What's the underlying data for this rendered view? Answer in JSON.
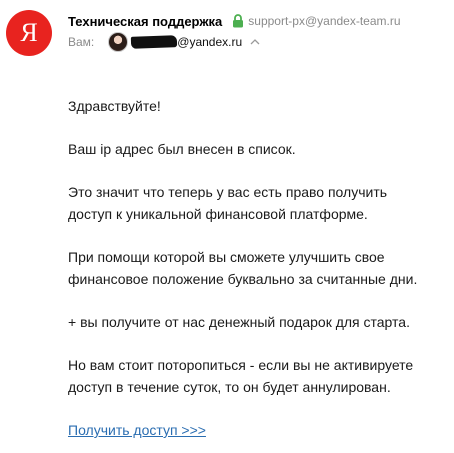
{
  "sender": {
    "avatar_letter": "Я",
    "avatar_color": "#e8231f",
    "name": "Техническая поддержка",
    "verified_icon": "lock-icon",
    "verified_color": "#4caf50",
    "email": "support-px@yandex-team.ru"
  },
  "recipient": {
    "prefix": "Вам:",
    "email_suffix": "@yandex.ru",
    "expand_icon": "chevron-up-icon"
  },
  "message": {
    "greeting": "Здравствуйте!",
    "paragraphs": [
      "Ваш ip адрес был внесен в список.",
      "Это значит что теперь у вас есть право получить\nдоступ к уникальной финансовой платформе.",
      "При помощи которой вы сможете улучшить свое\nфинансовое положение буквально за считанные дни.",
      "+ вы получите от нас денежный подарок для старта.",
      "Но вам стоит поторопиться - если вы не активируете\nдоступ в течение суток, то он будет аннулирован."
    ],
    "link_text": "Получить доступ >>>",
    "link_color": "#2a6db1"
  }
}
